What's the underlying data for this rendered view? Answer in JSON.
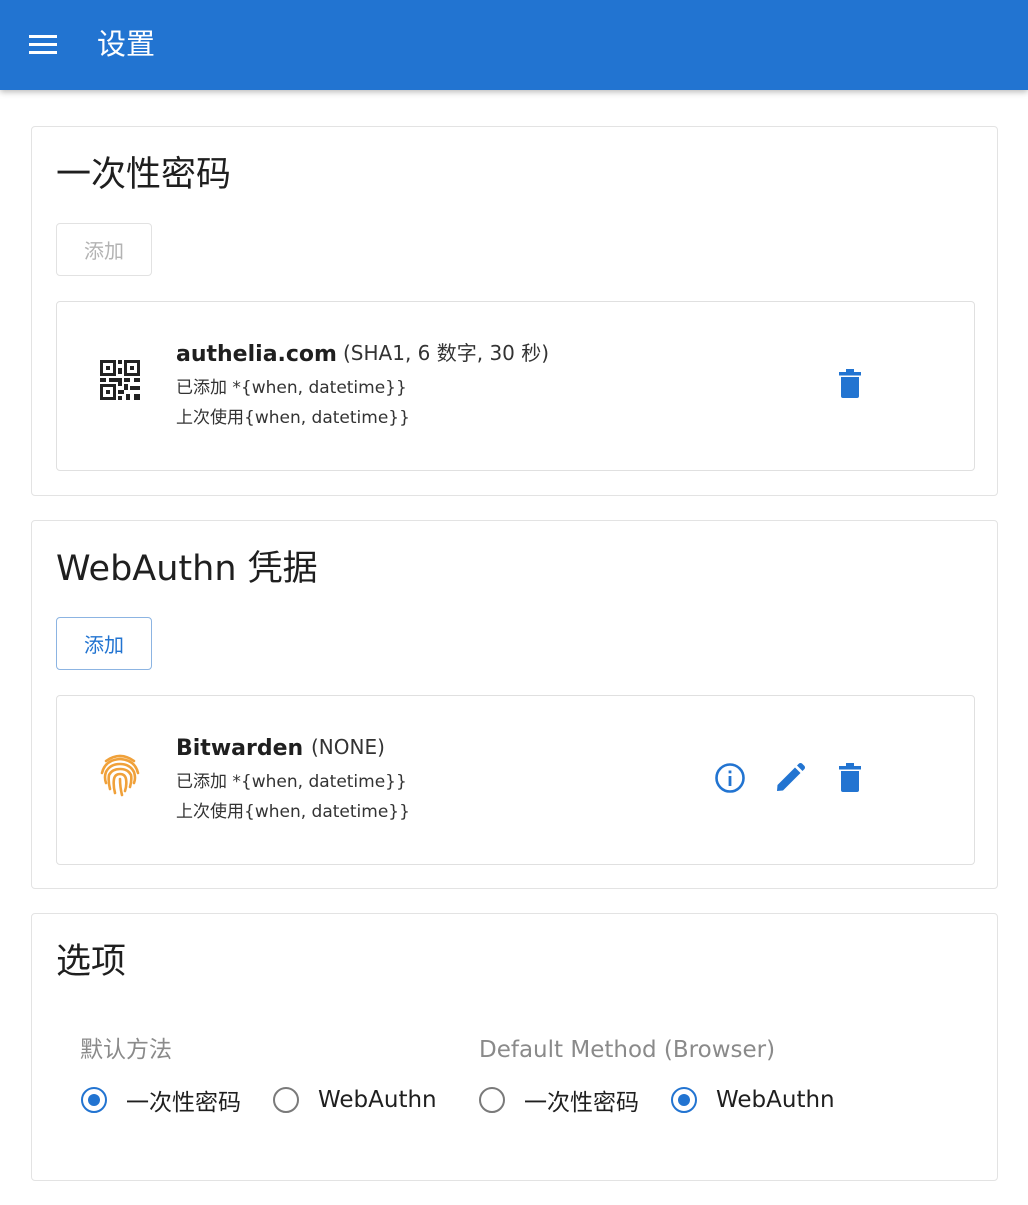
{
  "appbar": {
    "menu_icon": "menu-icon",
    "title": "设置"
  },
  "otp_section": {
    "title": "一次性密码",
    "add_label": "添加",
    "add_disabled": true,
    "item": {
      "icon": "qr-code-icon",
      "name": "authelia.com",
      "meta": "(SHA1, 6 数字, 30 秒)",
      "added": "已添加 *{when, datetime}}",
      "last_used": "上次使用{when, datetime}}",
      "actions": [
        "delete-icon"
      ]
    }
  },
  "webauthn_section": {
    "title": "WebAuthn 凭据",
    "add_label": "添加",
    "add_disabled": false,
    "item": {
      "icon": "fingerprint-icon",
      "name": "Bitwarden",
      "meta": "(NONE)",
      "added": "已添加 *{when, datetime}}",
      "last_used": "上次使用{when, datetime}}",
      "actions": [
        "info-icon",
        "edit-icon",
        "delete-icon"
      ]
    }
  },
  "options_section": {
    "title": "选项",
    "default_method": {
      "label": "默认方法",
      "options": [
        {
          "label": "一次性密码",
          "checked": true
        },
        {
          "label": "WebAuthn",
          "checked": false
        }
      ]
    },
    "browser_method": {
      "label": "Default Method (Browser)",
      "options": [
        {
          "label": "一次性密码",
          "checked": false
        },
        {
          "label": "WebAuthn",
          "checked": true
        }
      ]
    }
  },
  "colors": {
    "primary": "#2274d1",
    "fingerprint": "#f0a13a",
    "muted_text": "#8a8a8a"
  }
}
